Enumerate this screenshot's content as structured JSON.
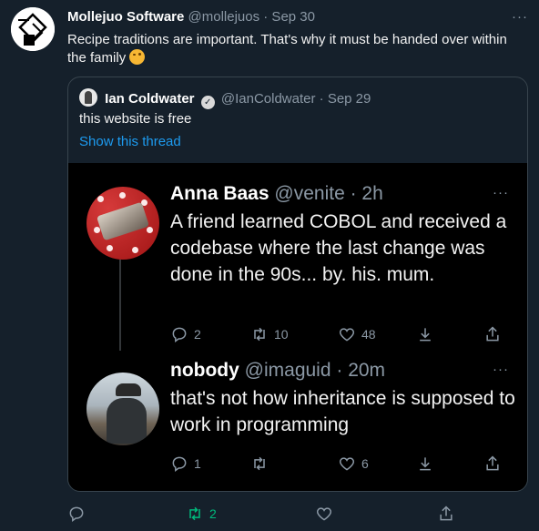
{
  "outer": {
    "name": "Mollejuo Software",
    "meta": "@mollejuos · Sep 30",
    "text": "Recipe traditions are important. That's why it must be handed over within the family",
    "actions": {
      "retweets": "2"
    }
  },
  "quote": {
    "name": "Ian Coldwater",
    "meta": "@IanColdwater · Sep 29",
    "text": "this website is free",
    "show_thread": "Show this thread"
  },
  "replies": [
    {
      "name": "Anna Baas",
      "meta": "@venite · 2h",
      "text": "A friend learned COBOL and received a codebase where the last change was done in the 90s... by. his. mum.",
      "replies": "2",
      "retweets": "10",
      "likes": "48"
    },
    {
      "name": "nobody",
      "meta": "@imaguid · 20m",
      "text": "that's not how inheritance is supposed to work in programming",
      "replies": "1",
      "retweets": "",
      "likes": "6"
    }
  ],
  "colors": {
    "background": "#15202b",
    "panel": "#000000",
    "link": "#1d9bf0",
    "retweet_active": "#00ba7c"
  },
  "icons": [
    "logo-icon",
    "wink-emoji-icon",
    "verified-badge-icon",
    "more-icon",
    "reply-icon",
    "retweet-icon",
    "like-icon",
    "download-icon",
    "share-icon"
  ]
}
